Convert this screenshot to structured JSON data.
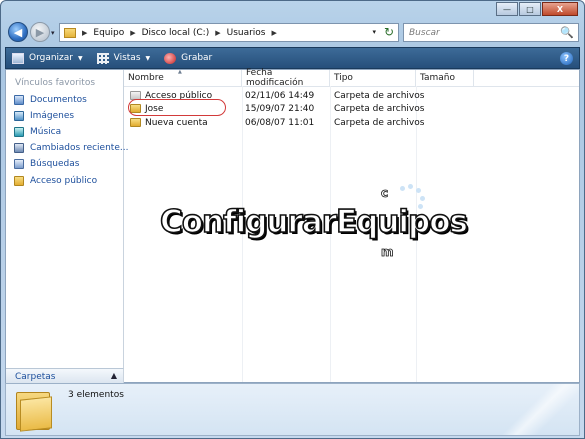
{
  "window": {
    "controls": {
      "minimize": "—",
      "maximize": "□",
      "close": "X"
    }
  },
  "nav_buttons": {
    "back": "◀",
    "forward": "▶",
    "history": "▾"
  },
  "address_bar": {
    "crumbs": [
      "Equipo",
      "Disco local (C:)",
      "Usuarios"
    ],
    "separator": "▶",
    "dropdown": "▾",
    "refresh": "↻"
  },
  "search": {
    "placeholder": "Buscar",
    "icon": "🔍"
  },
  "toolbar": {
    "organize_label": "Organizar",
    "views_label": "Vistas",
    "burn_label": "Grabar",
    "arrow": "▼",
    "help": "?"
  },
  "sidebar": {
    "heading": "Vínculos favoritos",
    "items": [
      {
        "label": "Documentos",
        "icon": "documents-icon"
      },
      {
        "label": "Imágenes",
        "icon": "pictures-icon"
      },
      {
        "label": "Música",
        "icon": "music-icon"
      },
      {
        "label": "Cambiados reciente...",
        "icon": "recent-icon"
      },
      {
        "label": "Búsquedas",
        "icon": "searches-icon"
      },
      {
        "label": "Acceso público",
        "icon": "public-folder-icon"
      }
    ],
    "folders_label": "Carpetas",
    "folders_chevron": "▲"
  },
  "file_list": {
    "columns": [
      "Nombre",
      "Fecha modificación",
      "Tipo",
      "Tamaño"
    ],
    "sort_indicator": "▲",
    "rows": [
      {
        "name": "Acceso público",
        "date": "02/11/06 14:49",
        "type": "Carpeta de archivos",
        "size": ""
      },
      {
        "name": "Jose",
        "date": "15/09/07 21:40",
        "type": "Carpeta de archivos",
        "size": ""
      },
      {
        "name": "Nueva cuenta",
        "date": "06/08/07 11:01",
        "type": "Carpeta de archivos",
        "size": ""
      }
    ]
  },
  "watermark": {
    "text": "ConfigurarEquipos",
    "suffix_top": "c",
    "suffix_bottom": "m"
  },
  "status": {
    "count_text": "3 elementos"
  }
}
